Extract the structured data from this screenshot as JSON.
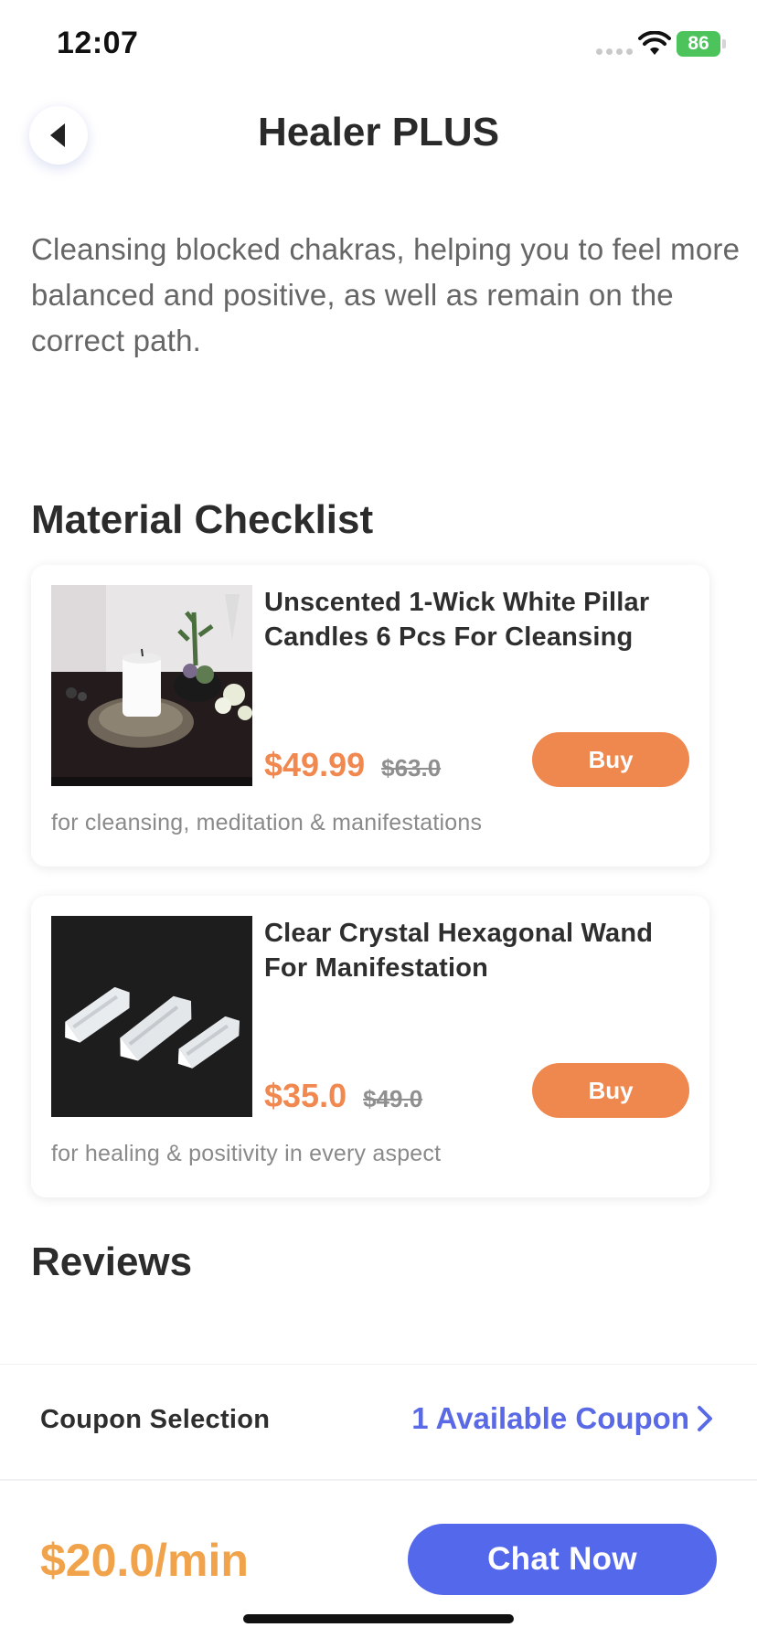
{
  "status_bar": {
    "time": "12:07",
    "battery": "86"
  },
  "header": {
    "title": "Healer PLUS",
    "back_icon": "chevron-left-icon"
  },
  "description": "Cleansing blocked chakras, helping you to feel more balanced and positive, as well as remain on the correct path.",
  "material_checklist": {
    "heading": "Material Checklist",
    "items": [
      {
        "name": "Unscented 1-Wick White Pillar Candles 6 Pcs For Cleansing",
        "price": "$49.99",
        "original_price": "$63.0",
        "buy_label": "Buy",
        "note": "for cleansing, meditation & manifestations"
      },
      {
        "name": "Clear Crystal Hexagonal Wand For Manifestation",
        "price": "$35.0",
        "original_price": "$49.0",
        "buy_label": "Buy",
        "note": "for healing & positivity in every aspect"
      }
    ]
  },
  "reviews": {
    "heading": "Reviews"
  },
  "coupon": {
    "label": "Coupon Selection",
    "link_text": "1 Available Coupon"
  },
  "footer": {
    "rate": "$20.0/min",
    "chat_label": "Chat Now"
  },
  "colors": {
    "accent_orange": "#ef884f",
    "rate_orange": "#f0a34a",
    "primary_blue": "#5468ec",
    "link_blue": "#5a6ae6"
  }
}
